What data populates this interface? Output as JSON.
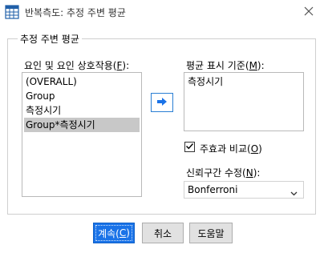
{
  "window": {
    "title": "반복측도: 추정 주변 평균",
    "icon": "spss-table-icon",
    "close_icon": "close-icon"
  },
  "group": {
    "legend": "추정 주변 평균"
  },
  "factors": {
    "label_prefix": "요인 및 요인 상호작용(",
    "label_key": "F",
    "label_suffix": "):",
    "items": [
      "(OVERALL)",
      "Group",
      "측정시기",
      "Group*측정시기"
    ],
    "selected_index": 3
  },
  "move_button": {
    "icon": "right-arrow-icon"
  },
  "display_means": {
    "label_prefix": "평균 표시 기준(",
    "label_key": "M",
    "label_suffix": "):",
    "items": [
      "측정시기"
    ]
  },
  "compare_main": {
    "label_prefix": "주효과 비교(",
    "label_key": "O",
    "label_suffix": ")",
    "checked": true
  },
  "ci_adjust": {
    "label_prefix": "신뢰구간 수정(",
    "label_key": "N",
    "label_suffix": "):",
    "value": "Bonferroni"
  },
  "buttons": {
    "continue_prefix": "계속(",
    "continue_key": "C",
    "continue_suffix": ")",
    "cancel": "취소",
    "help": "도움말"
  },
  "colors": {
    "accent": "#1a73e8",
    "selection": "#c8c8c8"
  }
}
